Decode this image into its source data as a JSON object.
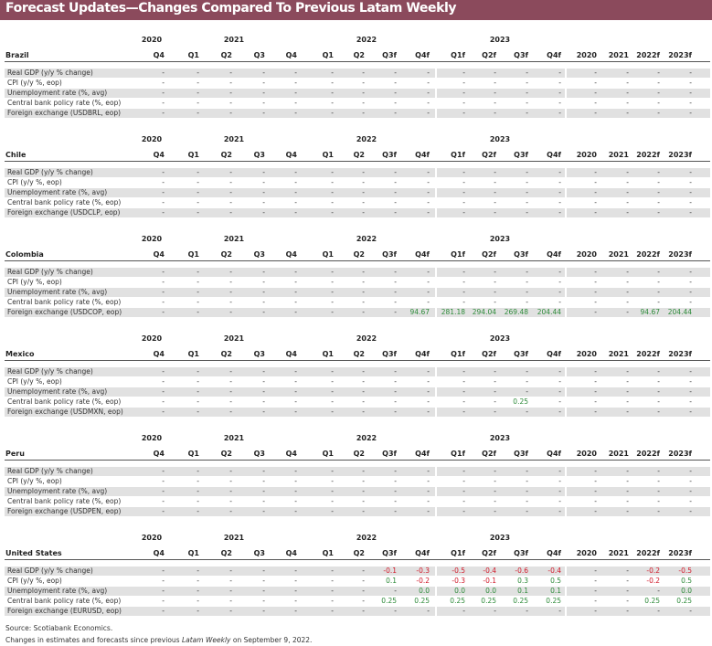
{
  "title": "Forecast Updates—Changes Compared To Previous Latam Weekly",
  "year_headers": [
    "2020",
    "2021",
    "2022",
    "2023"
  ],
  "quarter_headers": [
    "Q4",
    "Q1",
    "Q2",
    "Q3",
    "Q4",
    "Q1",
    "Q2",
    "Q3f",
    "Q4f",
    "Q1f",
    "Q2f",
    "Q3f",
    "Q4f"
  ],
  "annual_headers": [
    "2020",
    "2021",
    "2022f",
    "2023f"
  ],
  "row_labels": [
    "Real GDP (y/y % change)",
    "CPI (y/y %, eop)",
    "Unemployment rate (%, avg)",
    "Central bank policy rate (%, eop)",
    "Foreign exchange ({fx}, eop)"
  ],
  "sections": [
    {
      "country": "Brazil",
      "fx_label": "Foreign exchange (USDBRL, eop)",
      "rows": [
        [
          "-",
          "-",
          "-",
          "-",
          "-",
          "-",
          "-",
          "-",
          "-",
          "-",
          "-",
          "-",
          "-",
          "-",
          "-",
          "-",
          "-"
        ],
        [
          "-",
          "-",
          "-",
          "-",
          "-",
          "-",
          "-",
          "-",
          "-",
          "-",
          "-",
          "-",
          "-",
          "-",
          "-",
          "-",
          "-"
        ],
        [
          "-",
          "-",
          "-",
          "-",
          "-",
          "-",
          "-",
          "-",
          "-",
          "-",
          "-",
          "-",
          "-",
          "-",
          "-",
          "-",
          "-"
        ],
        [
          "-",
          "-",
          "-",
          "-",
          "-",
          "-",
          "-",
          "-",
          "-",
          "-",
          "-",
          "-",
          "-",
          "-",
          "-",
          "-",
          "-"
        ],
        [
          "-",
          "-",
          "-",
          "-",
          "-",
          "-",
          "-",
          "-",
          "-",
          "-",
          "-",
          "-",
          "-",
          "-",
          "-",
          "-",
          "-"
        ]
      ]
    },
    {
      "country": "Chile",
      "fx_label": "Foreign exchange (USDCLP, eop)",
      "rows": [
        [
          "-",
          "-",
          "-",
          "-",
          "-",
          "-",
          "-",
          "-",
          "-",
          "-",
          "-",
          "-",
          "-",
          "-",
          "-",
          "-",
          "-"
        ],
        [
          "-",
          "-",
          "-",
          "-",
          "-",
          "-",
          "-",
          "-",
          "-",
          "-",
          "-",
          "-",
          "-",
          "-",
          "-",
          "-",
          "-"
        ],
        [
          "-",
          "-",
          "-",
          "-",
          "-",
          "-",
          "-",
          "-",
          "-",
          "-",
          "-",
          "-",
          "-",
          "-",
          "-",
          "-",
          "-"
        ],
        [
          "-",
          "-",
          "-",
          "-",
          "-",
          "-",
          "-",
          "-",
          "-",
          "-",
          "-",
          "-",
          "-",
          "-",
          "-",
          "-",
          "-"
        ],
        [
          "-",
          "-",
          "-",
          "-",
          "-",
          "-",
          "-",
          "-",
          "-",
          "-",
          "-",
          "-",
          "-",
          "-",
          "-",
          "-",
          "-"
        ]
      ]
    },
    {
      "country": "Colombia",
      "fx_label": "Foreign exchange (USDCOP, eop)",
      "rows": [
        [
          "-",
          "-",
          "-",
          "-",
          "-",
          "-",
          "-",
          "-",
          "-",
          "-",
          "-",
          "-",
          "-",
          "-",
          "-",
          "-",
          "-"
        ],
        [
          "-",
          "-",
          "-",
          "-",
          "-",
          "-",
          "-",
          "-",
          "-",
          "-",
          "-",
          "-",
          "-",
          "-",
          "-",
          "-",
          "-"
        ],
        [
          "-",
          "-",
          "-",
          "-",
          "-",
          "-",
          "-",
          "-",
          "-",
          "-",
          "-",
          "-",
          "-",
          "-",
          "-",
          "-",
          "-"
        ],
        [
          "-",
          "-",
          "-",
          "-",
          "-",
          "-",
          "-",
          "-",
          "-",
          "-",
          "-",
          "-",
          "-",
          "-",
          "-",
          "-",
          "-"
        ],
        [
          "-",
          "-",
          "-",
          "-",
          "-",
          "-",
          "-",
          "-",
          "94.67",
          "281.18",
          "294.04",
          "269.48",
          "204.44",
          "-",
          "-",
          "94.67",
          "204.44"
        ]
      ]
    },
    {
      "country": "Mexico",
      "fx_label": "Foreign exchange (USDMXN, eop)",
      "rows": [
        [
          "-",
          "-",
          "-",
          "-",
          "-",
          "-",
          "-",
          "-",
          "-",
          "-",
          "-",
          "-",
          "-",
          "-",
          "-",
          "-",
          "-"
        ],
        [
          "-",
          "-",
          "-",
          "-",
          "-",
          "-",
          "-",
          "-",
          "-",
          "-",
          "-",
          "-",
          "-",
          "-",
          "-",
          "-",
          "-"
        ],
        [
          "-",
          "-",
          "-",
          "-",
          "-",
          "-",
          "-",
          "-",
          "-",
          "-",
          "-",
          "-",
          "-",
          "-",
          "-",
          "-",
          "-"
        ],
        [
          "-",
          "-",
          "-",
          "-",
          "-",
          "-",
          "-",
          "-",
          "-",
          "-",
          "-",
          "0.25",
          "-",
          "-",
          "-",
          "-",
          "-"
        ],
        [
          "-",
          "-",
          "-",
          "-",
          "-",
          "-",
          "-",
          "-",
          "-",
          "-",
          "-",
          "-",
          "-",
          "-",
          "-",
          "-",
          "-"
        ]
      ]
    },
    {
      "country": "Peru",
      "fx_label": "Foreign exchange (USDPEN, eop)",
      "rows": [
        [
          "-",
          "-",
          "-",
          "-",
          "-",
          "-",
          "-",
          "-",
          "-",
          "-",
          "-",
          "-",
          "-",
          "-",
          "-",
          "-",
          "-"
        ],
        [
          "-",
          "-",
          "-",
          "-",
          "-",
          "-",
          "-",
          "-",
          "-",
          "-",
          "-",
          "-",
          "-",
          "-",
          "-",
          "-",
          "-"
        ],
        [
          "-",
          "-",
          "-",
          "-",
          "-",
          "-",
          "-",
          "-",
          "-",
          "-",
          "-",
          "-",
          "-",
          "-",
          "-",
          "-",
          "-"
        ],
        [
          "-",
          "-",
          "-",
          "-",
          "-",
          "-",
          "-",
          "-",
          "-",
          "-",
          "-",
          "-",
          "-",
          "-",
          "-",
          "-",
          "-"
        ],
        [
          "-",
          "-",
          "-",
          "-",
          "-",
          "-",
          "-",
          "-",
          "-",
          "-",
          "-",
          "-",
          "-",
          "-",
          "-",
          "-",
          "-"
        ]
      ]
    },
    {
      "country": "United States",
      "fx_label": "Foreign exchange (EURUSD, eop)",
      "rows": [
        [
          "-",
          "-",
          "-",
          "-",
          "-",
          "-",
          "-",
          "-0.1",
          "-0.3",
          "-0.5",
          "-0.4",
          "-0.6",
          "-0.4",
          "-",
          "-",
          "-0.2",
          "-0.5"
        ],
        [
          "-",
          "-",
          "-",
          "-",
          "-",
          "-",
          "-",
          "0.1",
          "-0.2",
          "-0.3",
          "-0.1",
          "0.3",
          "0.5",
          "-",
          "-",
          "-0.2",
          "0.5"
        ],
        [
          "-",
          "-",
          "-",
          "-",
          "-",
          "-",
          "-",
          "-",
          "0.0",
          "0.0",
          "0.0",
          "0.1",
          "0.1",
          "-",
          "-",
          "-",
          "0.0"
        ],
        [
          "-",
          "-",
          "-",
          "-",
          "-",
          "-",
          "-",
          "0.25",
          "0.25",
          "0.25",
          "0.25",
          "0.25",
          "0.25",
          "-",
          "-",
          "0.25",
          "0.25"
        ],
        [
          "-",
          "-",
          "-",
          "-",
          "-",
          "-",
          "-",
          "-",
          "-",
          "-",
          "-",
          "-",
          "-",
          "-",
          "-",
          "-",
          "-"
        ]
      ]
    }
  ],
  "footer": {
    "source": "Source: Scotiabank Economics.",
    "note_prefix": "Changes in estimates and forecasts since previous ",
    "note_italic": "Latam Weekly",
    "note_suffix": " on September 9, 2022."
  },
  "colors": {
    "banner": "#8b4a5c",
    "positive": "#2e8b3a",
    "negative": "#d11a2a",
    "stripe": "#e1e1e1"
  }
}
